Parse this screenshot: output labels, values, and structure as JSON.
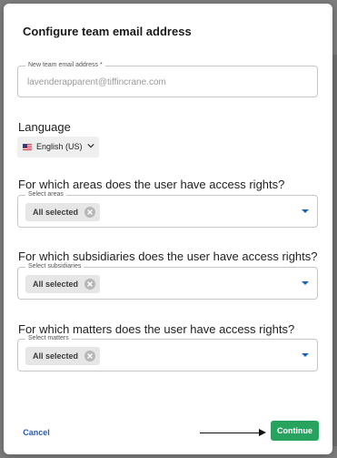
{
  "dialog": {
    "title": "Configure team email address"
  },
  "email": {
    "label": "New team email address *",
    "value": "lavenderapparent@tiffincrane.com"
  },
  "language": {
    "heading": "Language",
    "selected": "English (US)",
    "flag_icon": "us-flag-icon"
  },
  "areas": {
    "question": "For which areas does the user have access rights?",
    "field_label": "Select areas",
    "chip": "All selected"
  },
  "subsidiaries": {
    "question": "For which subsidiaries does the user have access rights?",
    "field_label": "Select subsidiaries",
    "chip": "All selected"
  },
  "matters": {
    "question": "For which matters does the user have access rights?",
    "field_label": "Select matters",
    "chip": "All selected"
  },
  "footer": {
    "cancel_label": "Cancel",
    "continue_label": "Continue"
  },
  "colors": {
    "accent_blue": "#2a5bb3",
    "continue_green": "#27a35f"
  }
}
